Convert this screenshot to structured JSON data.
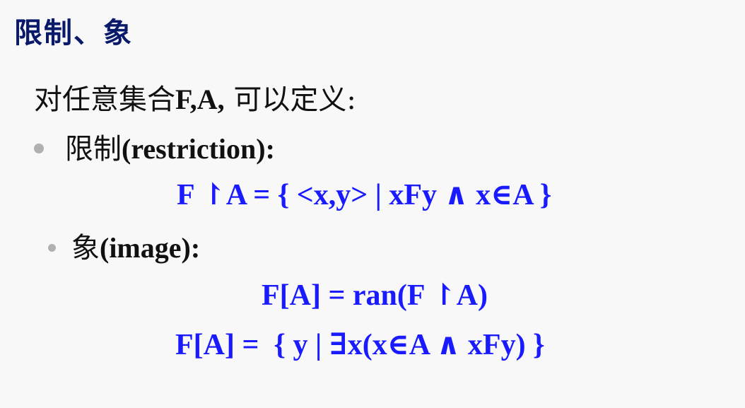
{
  "title": "限制、象",
  "intro": {
    "prefix": "对任意集合",
    "bold": "F,A,",
    "suffix": " 可以定义:"
  },
  "items": [
    {
      "label_cn": "限制",
      "label_en": "(restriction):",
      "formulas": [
        "F ↾A = { <x,y> | xFy ∧ x∈A }"
      ]
    },
    {
      "label_cn": "象",
      "label_en": "(image):",
      "formulas": [
        "F[A] = ran(F ↾A)",
        "F[A] =  { y | ∃x(x∈A ∧ xFy) }"
      ]
    }
  ]
}
